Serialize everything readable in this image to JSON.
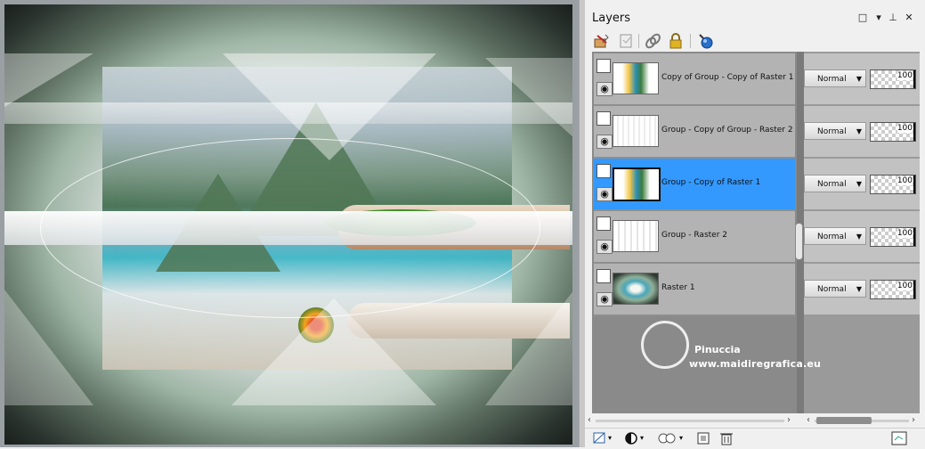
{
  "panel": {
    "title": "Layers",
    "window_controls": [
      "restore",
      "dropdown",
      "pin",
      "close"
    ]
  },
  "toolbar": {
    "icons": [
      "layer-properties-icon",
      "edit-selection-icon",
      "link-icon",
      "lock-icon",
      "new-layer-icon"
    ]
  },
  "layers": [
    {
      "name": "Copy of Group - Copy of Raster 1",
      "blend": "Normal",
      "opacity": "100",
      "selected": false
    },
    {
      "name": "Group - Copy of Group - Raster 2",
      "blend": "Normal",
      "opacity": "100",
      "selected": false
    },
    {
      "name": "Group - Copy of Raster 1",
      "blend": "Normal",
      "opacity": "100",
      "selected": true
    },
    {
      "name": "Group - Raster 2",
      "blend": "Normal",
      "opacity": "100",
      "selected": false
    },
    {
      "name": "Raster 1",
      "blend": "Normal",
      "opacity": "100",
      "selected": false
    }
  ],
  "watermark": {
    "name": "Pinuccia",
    "url": "www.maidiregrafica.eu"
  },
  "colors": {
    "selected_row": "#3399ff",
    "row_bg": "#b3b3b3",
    "panel_bg": "#f0f0f0"
  }
}
